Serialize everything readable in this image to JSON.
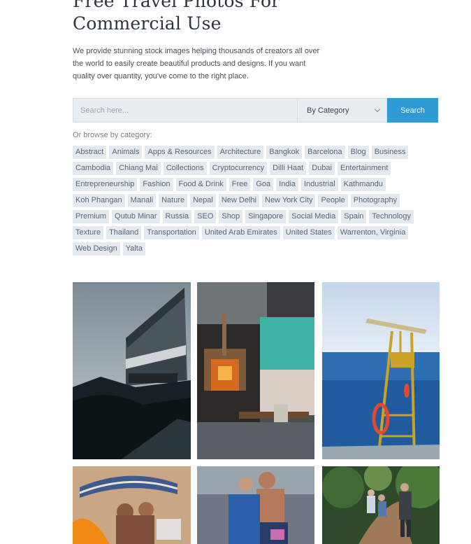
{
  "header": {
    "title": "Free Travel Photos For Commercial Use",
    "intro": "We provide stunning stock images helping thousands of creators all over the world to easily create beautiful products and designs. If you want quality over quantity, you've come to the right place."
  },
  "search": {
    "placeholder": "Search here...",
    "category_selected": "By Category",
    "button_label": "Search"
  },
  "browse": {
    "label": "Or browse by category:",
    "tags": [
      "Abstract",
      "Animals",
      "Apps & Resources",
      "Architecture",
      "Bangkok",
      "Barcelona",
      "Blog",
      "Business",
      "Cambodia",
      "Chiang Mai",
      "Collections",
      "Cryptocurrency",
      "Dilli Haat",
      "Dubai",
      "Entertainment",
      "Entrepreneurship",
      "Fashion",
      "Food & Drink",
      "Free",
      "Goa",
      "India",
      "Industrial",
      "Kathmandu",
      "Koh Phangan",
      "Manali",
      "Nature",
      "Nepal",
      "New Delhi",
      "New York City",
      "People",
      "Photography",
      "Premium",
      "Qutub Minar",
      "Russia",
      "SEO",
      "Shop",
      "Singapore",
      "Social Media",
      "Spain",
      "Technology",
      "Texture",
      "Thailand",
      "Transportation",
      "United Arab Emirates",
      "United States",
      "Warrenton, Virginia",
      "Web Design",
      "Yalta"
    ]
  },
  "photos": [
    {
      "subject": "modernist-building"
    },
    {
      "subject": "street-kitchen"
    },
    {
      "subject": "lifeguard-tower"
    },
    {
      "subject": "beach-umbrella"
    },
    {
      "subject": "father-child"
    },
    {
      "subject": "forest-hikers"
    }
  ],
  "colors": {
    "accent": "#2f9ad6",
    "tag_bg": "#e4eaf0",
    "title": "#2b3442"
  }
}
